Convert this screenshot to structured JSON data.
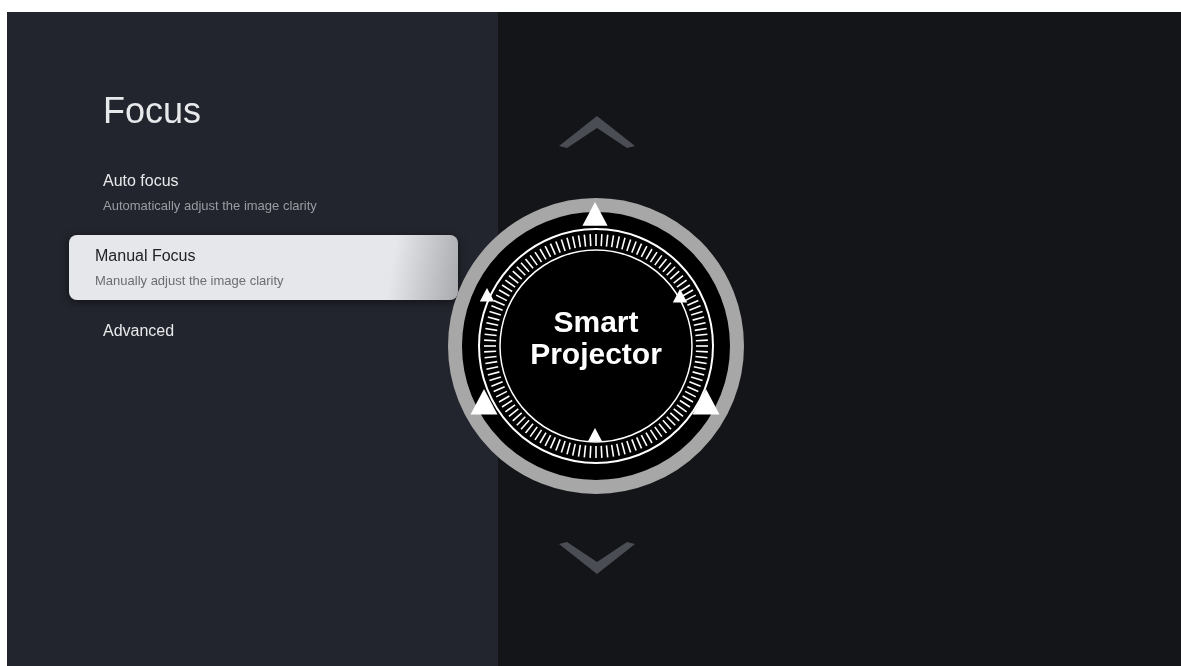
{
  "title": "Focus",
  "items": [
    {
      "label": "Auto focus",
      "description": "Automatically adjust the image clarity",
      "selected": false
    },
    {
      "label": "Manual Focus",
      "description": "Manually adjust the image clarity",
      "selected": true
    },
    {
      "label": "Advanced",
      "selected": false
    }
  ],
  "dial": {
    "lines": [
      "Smart",
      "Projector"
    ]
  }
}
